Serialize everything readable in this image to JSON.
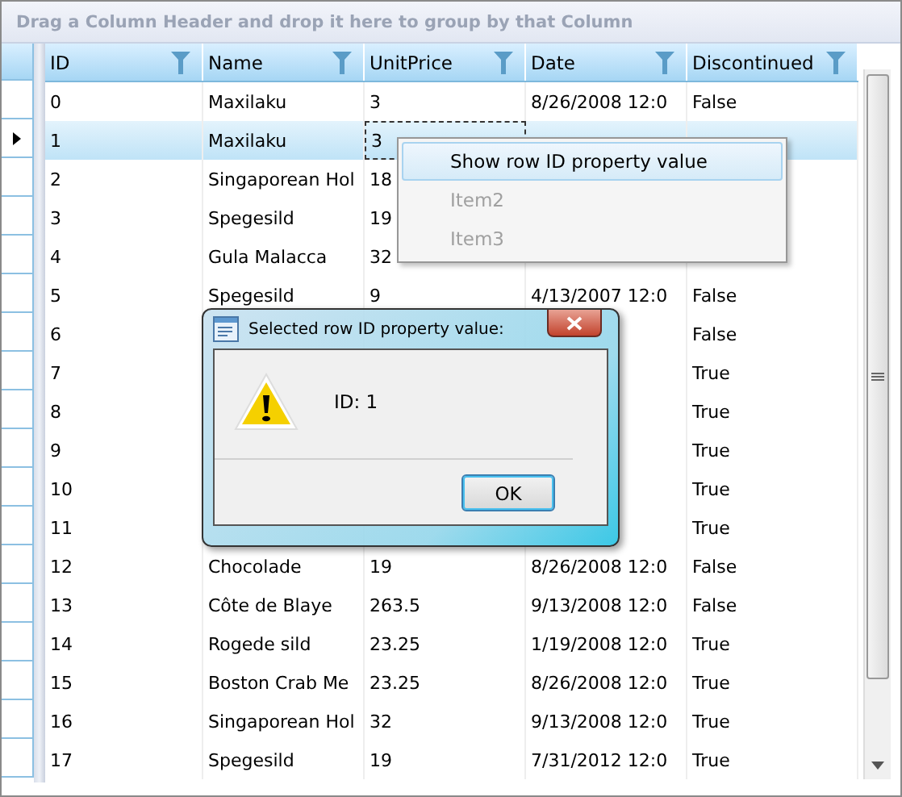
{
  "group_panel": {
    "hint": "Drag a Column Header and drop it here to group by that Column"
  },
  "table": {
    "columns": [
      {
        "label": "ID"
      },
      {
        "label": "Name"
      },
      {
        "label": "UnitPrice"
      },
      {
        "label": "Date"
      },
      {
        "label": "Discontinued"
      }
    ],
    "rows": [
      {
        "selected": false,
        "cells": [
          "0",
          "Maxilaku",
          "3",
          "8/26/2008 12:0",
          "False"
        ]
      },
      {
        "selected": true,
        "cells": [
          "1",
          "Maxilaku",
          "3",
          null,
          null
        ]
      },
      {
        "selected": false,
        "cells": [
          "2",
          "Singaporean Hol",
          "18",
          null,
          null
        ]
      },
      {
        "selected": false,
        "cells": [
          "3",
          "Spegesild",
          "19",
          null,
          null
        ]
      },
      {
        "selected": false,
        "cells": [
          "4",
          "Gula Malacca",
          "32",
          null,
          null
        ]
      },
      {
        "selected": false,
        "cells": [
          "5",
          "Spegesild",
          "9",
          "4/13/2007 12:0",
          "False"
        ]
      },
      {
        "selected": false,
        "cells": [
          "6",
          null,
          null,
          null,
          "False"
        ]
      },
      {
        "selected": false,
        "cells": [
          "7",
          null,
          null,
          null,
          "True"
        ]
      },
      {
        "selected": false,
        "cells": [
          "8",
          null,
          null,
          null,
          "True"
        ]
      },
      {
        "selected": false,
        "cells": [
          "9",
          null,
          null,
          null,
          "True"
        ]
      },
      {
        "selected": false,
        "cells": [
          "10",
          null,
          null,
          null,
          "True"
        ]
      },
      {
        "selected": false,
        "cells": [
          "11",
          null,
          null,
          null,
          "True"
        ]
      },
      {
        "selected": false,
        "cells": [
          "12",
          "Chocolade",
          "19",
          "8/26/2008 12:0",
          "False"
        ]
      },
      {
        "selected": false,
        "cells": [
          "13",
          "Côte de Blaye",
          "263.5",
          "9/13/2008 12:0",
          "False"
        ]
      },
      {
        "selected": false,
        "cells": [
          "14",
          "Rogede sild",
          "23.25",
          "1/19/2008 12:0",
          "True"
        ]
      },
      {
        "selected": false,
        "cells": [
          "15",
          "Boston Crab Me",
          "23.25",
          "8/26/2008 12:0",
          "True"
        ]
      },
      {
        "selected": false,
        "cells": [
          "16",
          "Singaporean Hol",
          "32",
          "9/13/2008 12:0",
          "True"
        ]
      },
      {
        "selected": false,
        "cells": [
          "17",
          "Spegesild",
          "19",
          "7/31/2012 12:0",
          "True"
        ]
      }
    ]
  },
  "context_menu": {
    "items": [
      {
        "label": "Show row ID property value",
        "selected": true,
        "disabled": false
      },
      {
        "label": "Item2",
        "selected": false,
        "disabled": true
      },
      {
        "label": "Item3",
        "selected": false,
        "disabled": true
      }
    ]
  },
  "dialog": {
    "title": "Selected row ID property value:",
    "message": "ID: 1",
    "buttons": [
      {
        "label": "OK"
      }
    ]
  }
}
